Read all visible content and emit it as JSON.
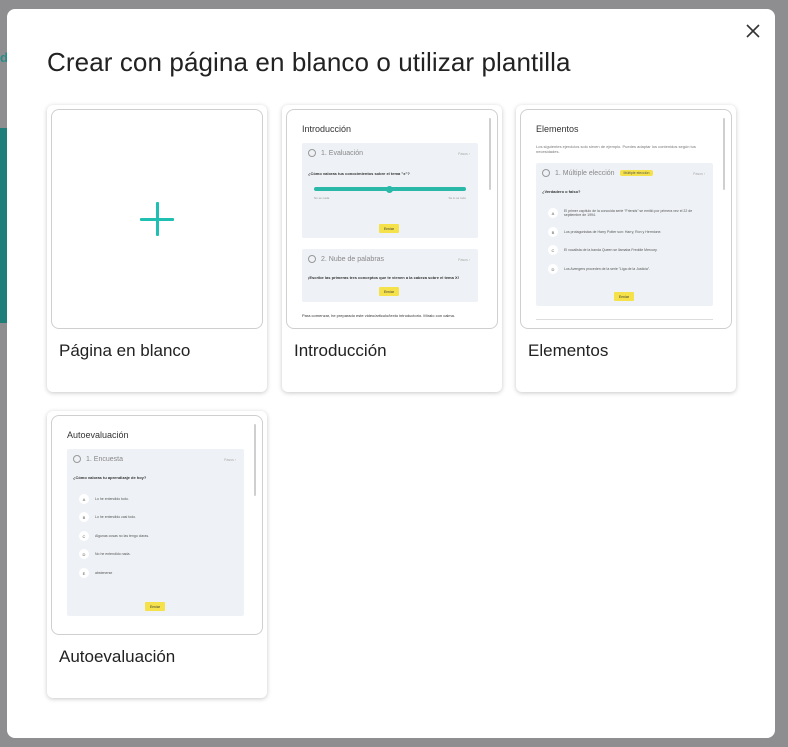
{
  "background": {
    "peek_char": "d"
  },
  "modal": {
    "title": "Crear con página en blanco o utilizar plantilla",
    "close_icon": "close-icon"
  },
  "templates": [
    {
      "label": "Página en blanco"
    },
    {
      "label": "Introducción",
      "thumb": {
        "title": "Introducción",
        "q1": {
          "head": "1. Evaluación",
          "meta": "Pasos ›",
          "ask": "¿Cómo valoras tus conocimientos sobre el tema \"x\"?",
          "left": "No sé nada",
          "right": "Sé lo sé todo",
          "btn": "Enviar"
        },
        "q2": {
          "head": "2. Nube de palabras",
          "meta": "Pasos ›",
          "ask": "¡Escribe las primeras tres conceptos que te vienen a la cabeza sobre el tema X!",
          "btn": "Enviar"
        },
        "foot": "Para comenzar, he preparado este video/articulo/texto introductorio. Míralo con calma."
      }
    },
    {
      "label": "Elementos",
      "thumb": {
        "title": "Elementos",
        "desc": "Los siguientes ejercicios solo sirven de ejemplo. Puedes adaptar los contenidos según tus necesidades.",
        "q1": {
          "head": "1. Múltiple elección",
          "tag": "Múltiple elección",
          "meta": "Pasos  ›",
          "ask": "¿Verdadero o falso?",
          "options": [
            {
              "letter": "A",
              "text": "El primer capítulo de la conocida serie \"Friends\" se emitió por primera vez el 22 de septiembre de 1994."
            },
            {
              "letter": "B",
              "text": "Los protagonistas de Harry Potter son: Harry, Ron y Hermione."
            },
            {
              "letter": "C",
              "text": "El vocalista de la banda Queen se llamaba Freddie Mercury."
            },
            {
              "letter": "D",
              "text": "Los Avengers proceden de la serie \"Liga de la Justicia\"."
            }
          ],
          "btn": "Enviar"
        }
      }
    },
    {
      "label": "Autoevaluación",
      "thumb": {
        "title": "Autoevaluación",
        "q1": {
          "head": "1. Encuesta",
          "meta": "Pasos ›",
          "ask": "¿Cómo valoras tu aprendizaje de hoy?",
          "options": [
            {
              "letter": "A",
              "text": "Lo he entendido todo."
            },
            {
              "letter": "B",
              "text": "Lo he entendido casi todo."
            },
            {
              "letter": "C",
              "text": "Algunas cosas no las tengo claras."
            },
            {
              "letter": "D",
              "text": "No he entendido nada."
            },
            {
              "letter": "E",
              "text": "abstenerse"
            }
          ],
          "btn": "Enviar"
        }
      }
    }
  ]
}
